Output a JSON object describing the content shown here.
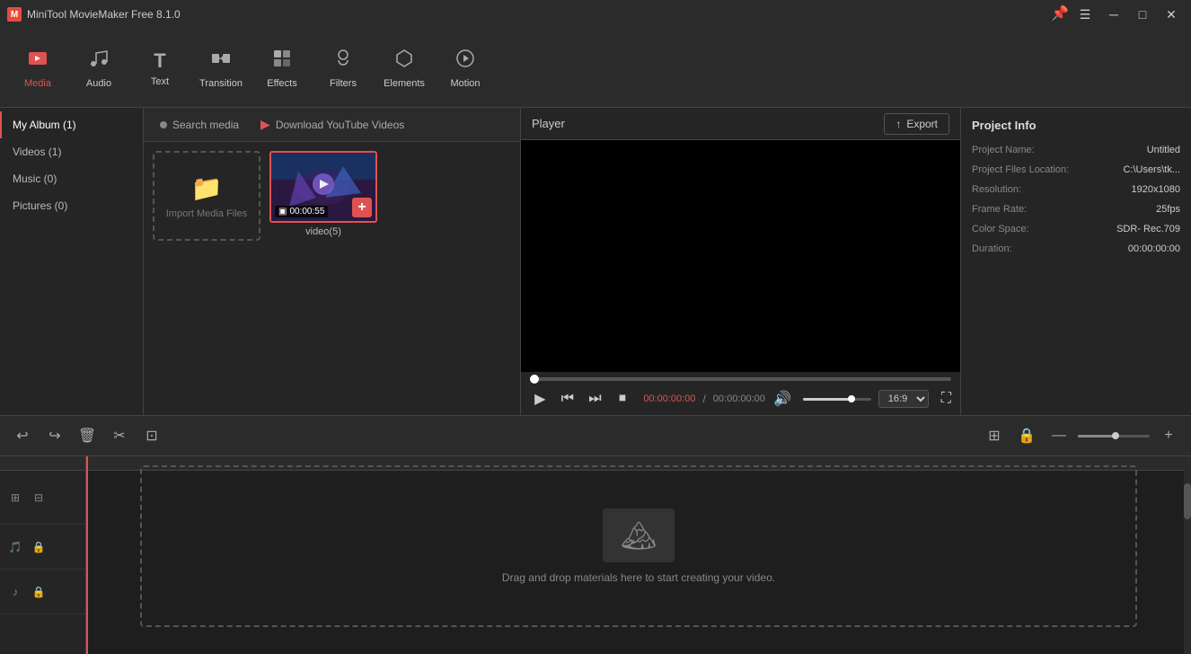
{
  "app": {
    "title": "MiniTool MovieMaker Free 8.1.0",
    "icon": "M"
  },
  "titlebar": {
    "controls": [
      "minimize",
      "maximize",
      "close"
    ],
    "pin_icon": "📌"
  },
  "toolbar": {
    "items": [
      {
        "id": "media",
        "label": "Media",
        "icon": "🎬",
        "active": true
      },
      {
        "id": "audio",
        "label": "Audio",
        "icon": "🎵",
        "active": false
      },
      {
        "id": "text",
        "label": "Text",
        "icon": "T",
        "active": false
      },
      {
        "id": "transition",
        "label": "Transition",
        "icon": "↔",
        "active": false
      },
      {
        "id": "effects",
        "label": "Effects",
        "icon": "⬛",
        "active": false
      },
      {
        "id": "filters",
        "label": "Filters",
        "icon": "☁",
        "active": false
      },
      {
        "id": "elements",
        "label": "Elements",
        "icon": "⬡",
        "active": false
      },
      {
        "id": "motion",
        "label": "Motion",
        "icon": "▷",
        "active": false
      }
    ]
  },
  "left_panel": {
    "items": [
      {
        "id": "my-album",
        "label": "My Album (1)",
        "active": true
      },
      {
        "id": "videos",
        "label": "Videos (1)",
        "active": false
      },
      {
        "id": "music",
        "label": "Music (0)",
        "active": false
      },
      {
        "id": "pictures",
        "label": "Pictures (0)",
        "active": false
      }
    ]
  },
  "media_panel": {
    "tabs": [
      {
        "id": "search",
        "label": "Search media",
        "icon": "dot"
      },
      {
        "id": "youtube",
        "label": "Download YouTube Videos",
        "icon": "youtube"
      }
    ],
    "import_label": "Import Media Files",
    "video_item": {
      "label": "video(5)",
      "duration": "00:00:55"
    }
  },
  "player": {
    "title": "Player",
    "export_label": "Export",
    "time_current": "00:00:00:00",
    "time_total": "00:00:00:00",
    "aspect_ratio": "16:9",
    "controls": {
      "play": "▶",
      "prev": "⏮",
      "next": "⏭",
      "stop": "⏹",
      "volume": "🔊"
    }
  },
  "project_info": {
    "title": "Project Info",
    "fields": [
      {
        "label": "Project Name:",
        "value": "Untitled"
      },
      {
        "label": "Project Files Location:",
        "value": "C:\\Users\\tk..."
      },
      {
        "label": "Resolution:",
        "value": "1920x1080"
      },
      {
        "label": "Frame Rate:",
        "value": "25fps"
      },
      {
        "label": "Color Space:",
        "value": "SDR- Rec.709"
      },
      {
        "label": "Duration:",
        "value": "00:00:00:00"
      }
    ]
  },
  "bottom_toolbar": {
    "left_buttons": [
      "undo",
      "redo",
      "delete",
      "cut",
      "crop"
    ],
    "right_buttons": [
      "zoom-out-icon",
      "zoom-in-icon"
    ],
    "zoom_minus": "—",
    "zoom_plus": "+"
  },
  "timeline": {
    "drop_text": "Drag and drop materials here to start creating your video.",
    "track_controls": [
      {
        "icon": "⊞",
        "icon2": "🔒"
      },
      {
        "icon": "🎵",
        "icon2": "🔒"
      }
    ]
  }
}
